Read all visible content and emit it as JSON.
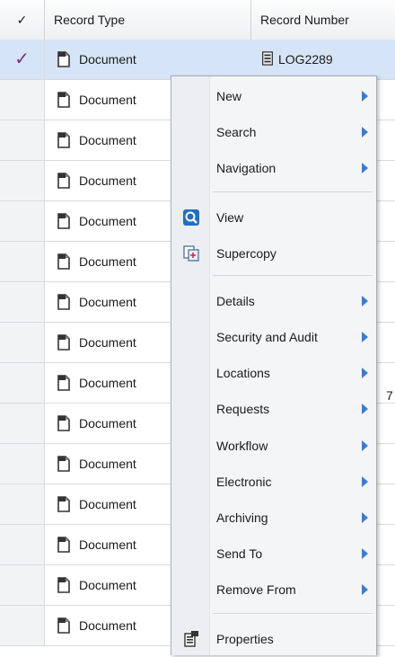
{
  "header": {
    "check_glyph": "✓",
    "record_type_label": "Record Type",
    "record_number_label": "Record Number"
  },
  "rows": [
    {
      "type": "Document",
      "number": "LOG2289",
      "selected": true
    },
    {
      "type": "Document",
      "number": ""
    },
    {
      "type": "Document",
      "number": ""
    },
    {
      "type": "Document",
      "number": ""
    },
    {
      "type": "Document",
      "number": ""
    },
    {
      "type": "Document",
      "number": ""
    },
    {
      "type": "Document",
      "number": ""
    },
    {
      "type": "Document",
      "number": ""
    },
    {
      "type": "Document",
      "number": ""
    },
    {
      "type": "Document",
      "number": ""
    },
    {
      "type": "Document",
      "number": ""
    },
    {
      "type": "Document",
      "number": ""
    },
    {
      "type": "Document",
      "number": ""
    },
    {
      "type": "Document",
      "number": ""
    },
    {
      "type": "Document",
      "number": ""
    }
  ],
  "row_check_glyph": "✓",
  "stray_char": "7",
  "context_menu": {
    "items": [
      {
        "label": "New",
        "submenu": true,
        "icon": ""
      },
      {
        "label": "Search",
        "submenu": true,
        "icon": ""
      },
      {
        "label": "Navigation",
        "submenu": true,
        "icon": ""
      },
      {
        "label": "View",
        "submenu": false,
        "icon": "magnifier-icon"
      },
      {
        "label": "Supercopy",
        "submenu": false,
        "icon": "supercopy-icon"
      },
      {
        "label": "Details",
        "submenu": true,
        "icon": ""
      },
      {
        "label": "Security and Audit",
        "submenu": true,
        "icon": ""
      },
      {
        "label": "Locations",
        "submenu": true,
        "icon": ""
      },
      {
        "label": "Requests",
        "submenu": true,
        "icon": ""
      },
      {
        "label": "Workflow",
        "submenu": true,
        "icon": ""
      },
      {
        "label": "Electronic",
        "submenu": true,
        "icon": ""
      },
      {
        "label": "Archiving",
        "submenu": true,
        "icon": ""
      },
      {
        "label": "Send To",
        "submenu": true,
        "icon": ""
      },
      {
        "label": "Remove From",
        "submenu": true,
        "icon": ""
      },
      {
        "label": "Properties",
        "submenu": false,
        "icon": "properties-icon"
      }
    ]
  },
  "colors": {
    "check": "#7b2c86",
    "selected_row": "#d6e4f7",
    "submenu_arrow": "#3a7bd5",
    "view_icon": "#1f6fc5"
  }
}
